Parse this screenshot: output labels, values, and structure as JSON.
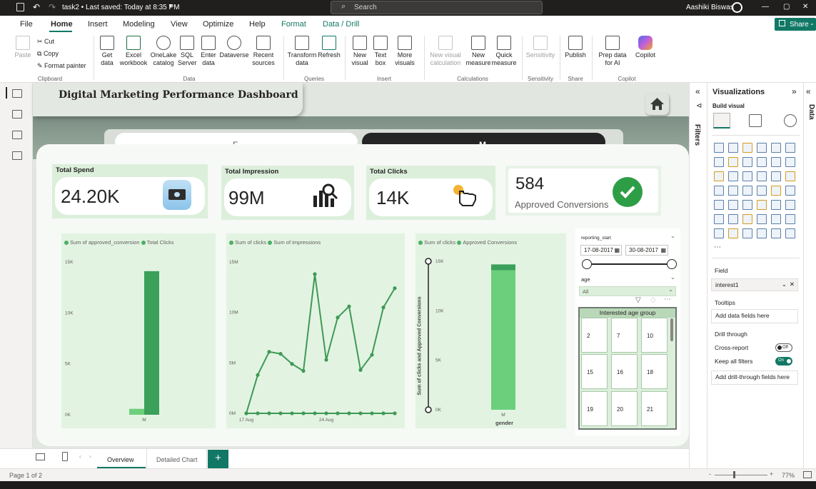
{
  "titlebar": {
    "doc_title": "task2 • Last saved: Today at 8:35 PM",
    "search_placeholder": "Search",
    "user_name": "Aashiki Biswas",
    "minimize": "—",
    "maximize": "▢",
    "close": "✕"
  },
  "menu": {
    "tabs": [
      "File",
      "Home",
      "Insert",
      "Modeling",
      "View",
      "Optimize",
      "Help",
      "Format",
      "Data / Drill"
    ],
    "active": "Home",
    "share_label": "Share"
  },
  "ribbon": {
    "clipboard": {
      "paste": "Paste",
      "cut": "Cut",
      "copy": "Copy",
      "format_painter": "Format painter",
      "group": "Clipboard"
    },
    "data": {
      "get_data": "Get data",
      "excel": "Excel workbook",
      "onelake": "OneLake catalog",
      "sql": "SQL Server",
      "enter_data": "Enter data",
      "dataverse": "Dataverse",
      "recent": "Recent sources",
      "group": "Data"
    },
    "queries": {
      "transform": "Transform data",
      "refresh": "Refresh",
      "group": "Queries"
    },
    "insert": {
      "new_visual": "New visual",
      "text_box": "Text box",
      "more_visuals": "More visuals",
      "group": "Insert"
    },
    "calculations": {
      "new_visual_calc": "New visual calculation",
      "new_measure": "New measure",
      "quick_measure": "Quick measure",
      "group": "Calculations"
    },
    "sensitivity": {
      "label": "Sensitivity",
      "group": "Sensitivity"
    },
    "share": {
      "publish": "Publish",
      "group": "Share"
    },
    "copilot": {
      "prep": "Prep data for AI",
      "copilot": "Copilot",
      "group": "Copilot"
    }
  },
  "dashboard": {
    "title": "Digital Marketing Performance Dashboard",
    "toggle_f": "F",
    "toggle_m": "M",
    "kpis": [
      {
        "label": "Total Spend",
        "value": "24.20K"
      },
      {
        "label": "Total Impression",
        "value": "99M"
      },
      {
        "label": "Total Clicks",
        "value": "14K"
      }
    ],
    "conversions": {
      "value": "584",
      "label": "Approved Conversions"
    }
  },
  "charts": {
    "chart1": {
      "legend": [
        "Sum of approved_conversion",
        "Total Clicks"
      ],
      "yticks": [
        "15K",
        "10K",
        "5K",
        "0K"
      ],
      "xlabel_cat": "M"
    },
    "chart2": {
      "legend": [
        "Sum of clicks",
        "Sum of impressions"
      ],
      "yticks": [
        "15M",
        "10M",
        "5M",
        "0M"
      ],
      "xticks": [
        "17 Aug",
        "24 Aug"
      ]
    },
    "chart3": {
      "legend": [
        "Sum of clicks",
        "Approved Conversions"
      ],
      "ylabel": "Sum of clicks and Approved Conversions",
      "yticks": [
        "15K",
        "10K",
        "5K",
        "0K"
      ],
      "xlabel_cat": "M",
      "xlabel": "gender"
    }
  },
  "chart_data": [
    {
      "type": "bar",
      "categories": [
        "M"
      ],
      "series": [
        {
          "name": "Sum of approved_conversion",
          "values": [
            584
          ]
        },
        {
          "name": "Total Clicks",
          "values": [
            14100
          ]
        }
      ],
      "ylim": [
        0,
        15000
      ],
      "legend": "top-left"
    },
    {
      "type": "line",
      "x": [
        "17 Aug",
        "18 Aug",
        "19 Aug",
        "20 Aug",
        "21 Aug",
        "22 Aug",
        "23 Aug",
        "24 Aug",
        "25 Aug",
        "26 Aug",
        "27 Aug",
        "28 Aug",
        "29 Aug",
        "30 Aug"
      ],
      "series": [
        {
          "name": "Sum of clicks",
          "values": [
            0,
            0,
            0,
            0,
            0,
            0,
            0,
            0,
            0,
            0,
            0,
            0,
            0,
            0
          ]
        },
        {
          "name": "Sum of impressions",
          "values": [
            0,
            3.8,
            6.1,
            5.9,
            4.9,
            4.2,
            13.8,
            5.3,
            9.5,
            10.6,
            4.3,
            5.8,
            10.5,
            12.4
          ]
        }
      ],
      "xticks_labeled": [
        "17 Aug",
        "24 Aug"
      ],
      "yunit": "M",
      "ylim": [
        0,
        15
      ],
      "legend": "top-left"
    },
    {
      "type": "bar",
      "stacked": true,
      "categories": [
        "M"
      ],
      "series": [
        {
          "name": "Sum of clicks",
          "values": [
            14100
          ]
        },
        {
          "name": "Approved Conversions",
          "values": [
            584
          ]
        }
      ],
      "xlabel": "gender",
      "ylabel": "Sum of clicks and Approved Conversions",
      "ylim": [
        0,
        15000
      ],
      "legend": "top-left"
    }
  ],
  "slicers": {
    "date": {
      "title": "reporting_start",
      "start": "17-08-2017",
      "end": "30-08-2017"
    },
    "age": {
      "title": "age",
      "value": "All"
    },
    "interest": {
      "title": "Interested age group",
      "tiles": [
        "2",
        "7",
        "10",
        "15",
        "16",
        "18",
        "19",
        "20",
        "21"
      ]
    }
  },
  "pane": {
    "filters_label": "Filters",
    "viz_title": "Visualizations",
    "build_visual": "Build visual",
    "field_title": "Field",
    "field_value": "interest1",
    "tooltips_title": "Tooltips",
    "tooltips_placeholder": "Add data fields here",
    "drill_title": "Drill through",
    "cross_report": "Cross-report",
    "cross_report_state": "Off",
    "keep_filters": "Keep all filters",
    "keep_filters_state": "On",
    "drill_placeholder": "Add drill-through fields here",
    "data_label": "Data"
  },
  "pages": {
    "tabs": [
      "Overview",
      "Detailed Chart"
    ],
    "active": "Overview",
    "add": "+"
  },
  "status": {
    "page": "Page 1 of 2",
    "zoom": "77%"
  },
  "colors": {
    "accent": "#117865",
    "bar_dark": "#3aa05a",
    "bar_light": "#6ccf7c",
    "line": "#3d9a55",
    "kpi_bg": "#dcefdb"
  }
}
